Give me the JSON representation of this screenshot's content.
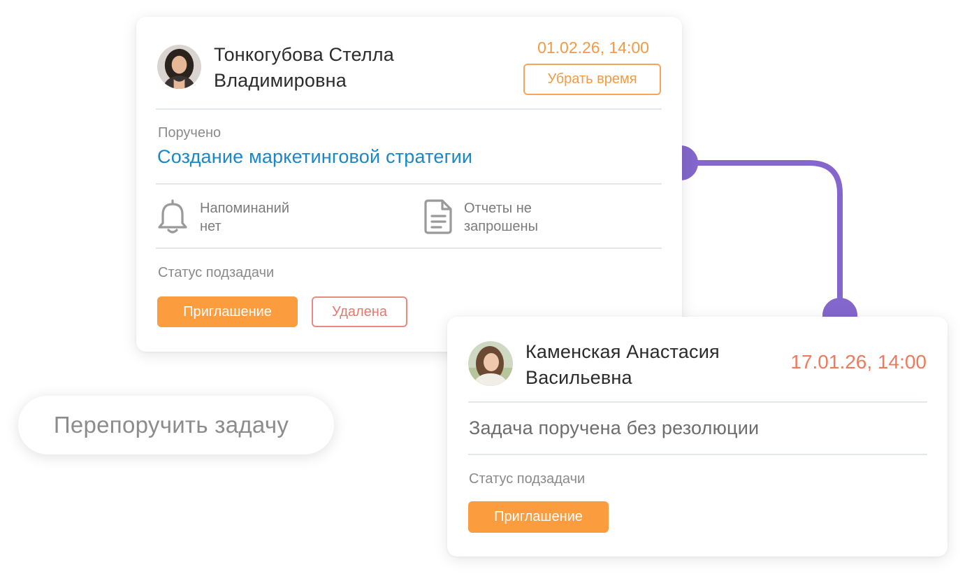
{
  "card_top": {
    "person_name_line1": "Тонкогубова Стелла",
    "person_name_line2": "Владимировна",
    "datetime": "01.02.26, 14:00",
    "remove_time_label": "Убрать время",
    "assigned_label": "Поручено",
    "task_title": "Создание маркетинговой стратегии",
    "reminders_line1": "Напоминаний",
    "reminders_line2": "нет",
    "reports_line1": "Отчеты не",
    "reports_line2": "запрошены",
    "status_label": "Статус подзадачи",
    "status_invite": "Приглашение",
    "status_deleted": "Удалена"
  },
  "card_bottom": {
    "person_name_line1": "Каменская Анастасия",
    "person_name_line2": "Васильевна",
    "datetime": "17.01.26, 14:00",
    "resolution_text": "Задача поручена без резолюции",
    "status_label": "Статус подзадачи",
    "status_invite": "Приглашение"
  },
  "reassign_label": "Перепоручить задачу",
  "colors": {
    "accent_orange": "#fb9c3e",
    "datetime_orange": "#f39a45",
    "datetime_red": "#ee7a5e",
    "link_blue": "#1b86c8",
    "connector_purple": "#8466cc",
    "deleted_red": "#e27a6f"
  },
  "icons": {
    "reminders": "bell-icon",
    "reports": "document-icon"
  }
}
